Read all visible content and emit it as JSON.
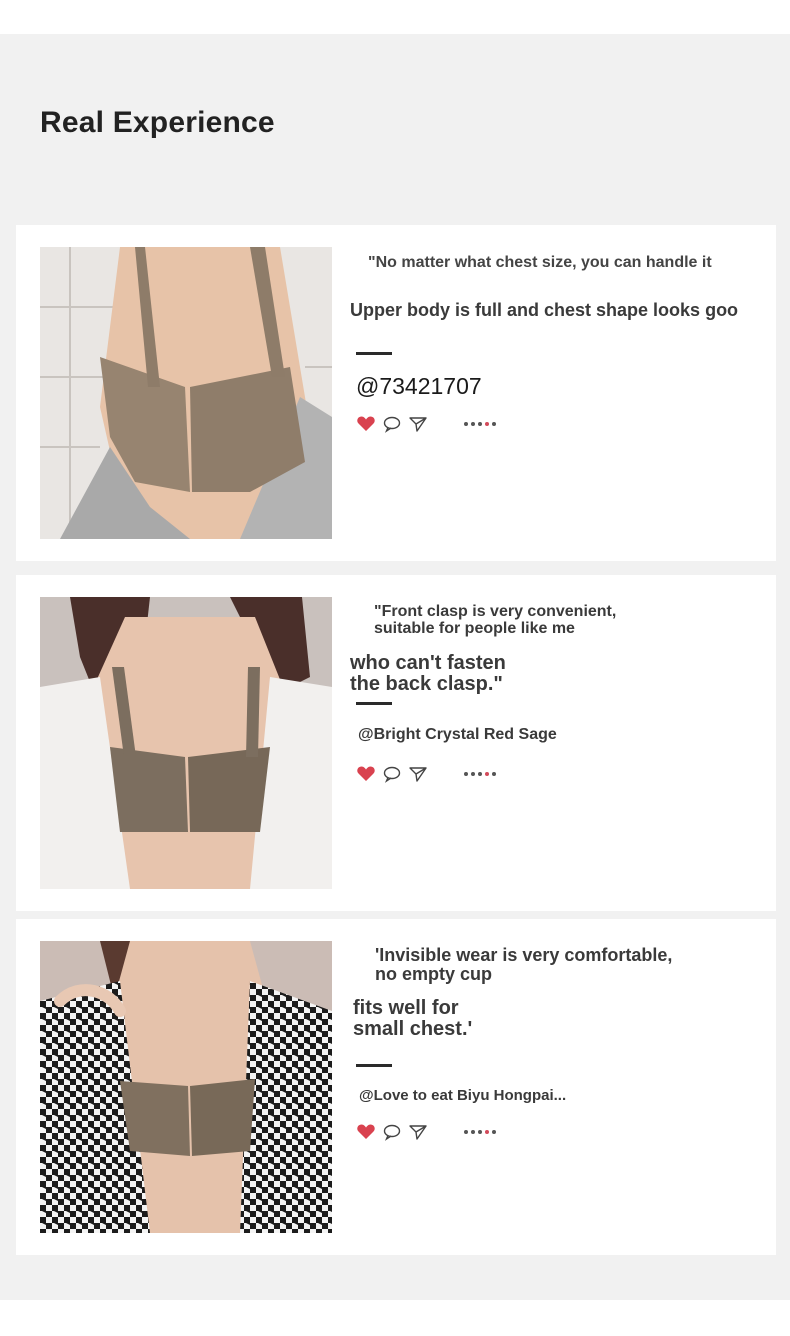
{
  "section_title": "Real Experience",
  "colors": {
    "like_heart": "#d9424f",
    "card_bg": "#ffffff",
    "panel_bg": "#f1f1f1"
  },
  "reviews": [
    {
      "quote_line1": "\"No matter what chest size, you can handle it",
      "quote_line2": "Upper body is full and chest shape looks goo",
      "username": "@73421707",
      "icons": [
        "heart-icon",
        "comment-icon",
        "share-icon",
        "more-dots-icon"
      ]
    },
    {
      "quote_line1": "\"Front clasp is very convenient,",
      "quote_line2": "suitable for people like me",
      "quote_line3": "who can't fasten",
      "quote_line4": "the back clasp.\"",
      "username": "@Bright Crystal Red Sage",
      "icons": [
        "heart-icon",
        "comment-icon",
        "share-icon",
        "more-dots-icon"
      ]
    },
    {
      "quote_line1": "'Invisible wear is very comfortable,",
      "quote_line2": "no empty cup",
      "quote_line3": "fits well for",
      "quote_line4": "small chest.'",
      "username": "@Love to eat Biyu Hongpai...",
      "icons": [
        "heart-icon",
        "comment-icon",
        "share-icon",
        "more-dots-icon"
      ]
    }
  ]
}
